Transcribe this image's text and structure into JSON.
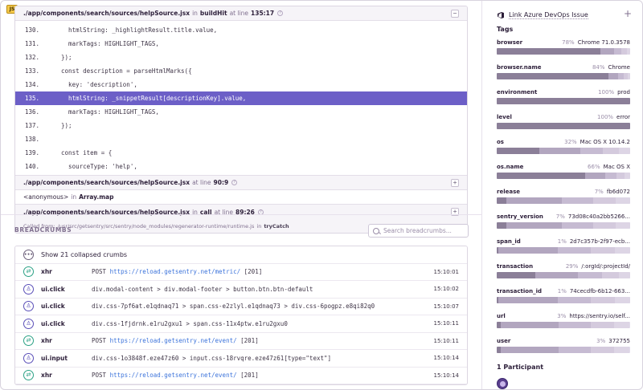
{
  "badge": "JS",
  "trace": {
    "frame1": {
      "path": "./app/components/search/sources/helpSource.jsx",
      "in": "in",
      "fn": "buildHit",
      "at": "at line",
      "line": "135:17",
      "toggle": "−"
    },
    "code": [
      {
        "n": "130.",
        "text": "    htmlString: _highlightResult.title.value,"
      },
      {
        "n": "131.",
        "text": "    markTags: HIGHLIGHT_TAGS,"
      },
      {
        "n": "132.",
        "text": "  });"
      },
      {
        "n": "133.",
        "text": "  const description = parseHtmlMarks({"
      },
      {
        "n": "134.",
        "text": "    key: 'description',"
      },
      {
        "n": "135.",
        "text": "    htmlString: _snippetResult[descriptionKey].value,"
      },
      {
        "n": "136.",
        "text": "    markTags: HIGHLIGHT_TAGS,"
      },
      {
        "n": "137.",
        "text": "  });"
      },
      {
        "n": "138.",
        "text": ""
      },
      {
        "n": "139.",
        "text": "  const item = {"
      },
      {
        "n": "140.",
        "text": "    sourceType: 'help',"
      }
    ],
    "frame2": {
      "path": "./app/components/search/sources/helpSource.jsx",
      "at": "at line",
      "line": "90:9",
      "toggle": "+"
    },
    "frame3": {
      "anon": "<anonymous>",
      "in": "in",
      "fn": "Array.map"
    },
    "frame4": {
      "path": "./app/components/search/sources/helpSource.jsx",
      "in": "in",
      "fn": "call",
      "at": "at line",
      "line": "89:26",
      "toggle": "+"
    },
    "called": {
      "label": "Called from:",
      "path": "/usr/src/getsentry/src/sentry/node_modules/regenerator-runtime/runtime.js",
      "in": "in",
      "fn": "tryCatch"
    }
  },
  "breadcrumbs": {
    "title": "BREADCRUMBS",
    "search_placeholder": "Search breadcrumbs...",
    "collapsed": "Show 21 collapsed crumbs",
    "rows": [
      {
        "cat": "xhr",
        "method": "POST ",
        "url": "https://reload.getsentry.net/metric/",
        "tail": " [201]",
        "msg": "",
        "time": "15:10:01"
      },
      {
        "cat": "ui.click",
        "method": "",
        "url": "",
        "tail": "",
        "msg": "div.modal-content > div.modal-footer > button.btn.btn-default",
        "time": "15:10:02"
      },
      {
        "cat": "ui.click",
        "method": "",
        "url": "",
        "tail": "",
        "msg": "div.css-7pf6at.e1qdnaq71 > span.css-e2zlyl.e1qdnaq73 > div.css-6pogpz.e8qi82q0",
        "time": "15:10:07"
      },
      {
        "cat": "ui.click",
        "method": "",
        "url": "",
        "tail": "",
        "msg": "div.css-1fjdrnk.e1ru2gxu1 > span.css-11x4ptw.e1ru2gxu0",
        "time": "15:10:11"
      },
      {
        "cat": "xhr",
        "method": "POST ",
        "url": "https://reload.getsentry.net/event/",
        "tail": " [201]",
        "msg": "",
        "time": "15:10:11"
      },
      {
        "cat": "ui.input",
        "method": "",
        "url": "",
        "tail": "",
        "msg": "div.css-1o3848f.eze47z60 > input.css-18rvqre.eze47z61[type=\"text\"]",
        "time": "15:10:14"
      },
      {
        "cat": "xhr",
        "method": "POST ",
        "url": "https://reload.getsentry.net/event/",
        "tail": " [201]",
        "msg": "",
        "time": "15:10:14"
      }
    ]
  },
  "sidebar": {
    "link_label": "Link Azure DevOps Issue",
    "plus": "+",
    "tags_title": "Tags",
    "tags": [
      {
        "key": "browser",
        "pct": "78%",
        "val": "Chrome 71.0.3578",
        "fill": 0.78
      },
      {
        "key": "browser.name",
        "pct": "84%",
        "val": "Chrome",
        "fill": 0.84
      },
      {
        "key": "environment",
        "pct": "100%",
        "val": "prod",
        "fill": 1.0
      },
      {
        "key": "level",
        "pct": "100%",
        "val": "error",
        "fill": 1.0
      },
      {
        "key": "os",
        "pct": "32%",
        "val": "Mac OS X 10.14.2",
        "fill": 0.32
      },
      {
        "key": "os.name",
        "pct": "66%",
        "val": "Mac OS X",
        "fill": 0.66
      },
      {
        "key": "release",
        "pct": "7%",
        "val": "fb6d072",
        "fill": 0.07
      },
      {
        "key": "sentry_version",
        "pct": "7%",
        "val": "73d08c40a2bb5266...",
        "fill": 0.07
      },
      {
        "key": "span_id",
        "pct": "1%",
        "val": "2d7c357b-2f97-ecb...",
        "fill": 0.01
      },
      {
        "key": "transaction",
        "pct": "29%",
        "val": "/:orgId/:projectId/",
        "fill": 0.29
      },
      {
        "key": "transaction_id",
        "pct": "1%",
        "val": "74cecdfb-6b12-663...",
        "fill": 0.01
      },
      {
        "key": "url",
        "pct": "3%",
        "val": "https://sentry.io/self...",
        "fill": 0.03
      },
      {
        "key": "user",
        "pct": "3%",
        "val": "372755",
        "fill": 0.03
      }
    ],
    "participants": "1 Participant"
  },
  "colors": {
    "accent": "#6c5fc7",
    "xhr": "#2ba185",
    "ui": "#5a4fb8",
    "link": "#3d74db"
  }
}
